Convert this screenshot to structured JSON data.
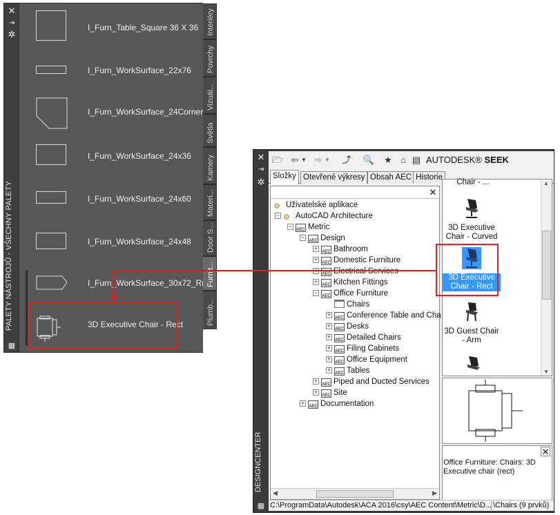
{
  "tool_palette": {
    "title": "PALETY NÁSTROJŮ - VŠECHNY PALETY",
    "tools": [
      {
        "label": "I_Furn_Table_Square 36 X 36"
      },
      {
        "label": "I_Furn_WorkSurface_22x76"
      },
      {
        "label": "I_Furn_WorkSurface_24Corner"
      },
      {
        "label": "I_Furn_WorkSurface_24x36"
      },
      {
        "label": "I_Furn_WorkSurface_24x60"
      },
      {
        "label": "I_Furn_WorkSurface_24x48"
      },
      {
        "label": "I_Furn_WorkSurface_30x72_Rnd"
      },
      {
        "label": "3D Executive Chair - Rect"
      }
    ],
    "tabs": [
      "Interiéry",
      "Povrchy",
      "Vizuál...",
      "Světla",
      "Kamery",
      "Materi...",
      "Door S...",
      "Furnit...",
      "Plumb..."
    ],
    "active_tab": "Furnit..."
  },
  "design_center": {
    "title": "DESIGNCENTER",
    "seek_label_brand": "AUTODESK",
    "seek_label_product": "SEEK",
    "tabs": [
      "Složky",
      "Otevřené výkresy",
      "Obsah AEC",
      "Historie"
    ],
    "selected_tab": "Složky",
    "tree": [
      {
        "label": "Uživatelské aplikace"
      },
      {
        "label": "AutoCAD Architecture"
      },
      {
        "label": "Metric"
      },
      {
        "label": "Design"
      },
      {
        "label": "Bathroom"
      },
      {
        "label": "Domestic Furniture"
      },
      {
        "label": "Electrical Services"
      },
      {
        "label": "Kitchen Fittings"
      },
      {
        "label": "Office Furniture"
      },
      {
        "label": "Chairs"
      },
      {
        "label": "Conference Table and Cha"
      },
      {
        "label": "Desks"
      },
      {
        "label": "Detailed Chairs"
      },
      {
        "label": "Filing Cabinets"
      },
      {
        "label": "Office Equipment"
      },
      {
        "label": "Tables"
      },
      {
        "label": "Piped and Ducted Services"
      },
      {
        "label": "Site"
      },
      {
        "label": "Documentation"
      }
    ],
    "content_items": [
      {
        "label": "Chair - ..."
      },
      {
        "label": "3D Executive Chair - Curved"
      },
      {
        "label": "3D Executive Chair - Rect"
      },
      {
        "label": "3D Guest Chair - Arm"
      }
    ],
    "selected_item": "3D Executive Chair - Rect",
    "description": "Office Furniture: Chairs: 3D Executive chair (rect)",
    "status_path": "C:\\ProgramData\\Autodesk\\ACA 2016\\csy\\AEC Content\\Metric\\D...",
    "status_count": "\\Chairs (9 prvků)"
  },
  "colors": {
    "highlight": "#e02020",
    "selection": "#3399ff",
    "palette_bg": "#585858"
  }
}
